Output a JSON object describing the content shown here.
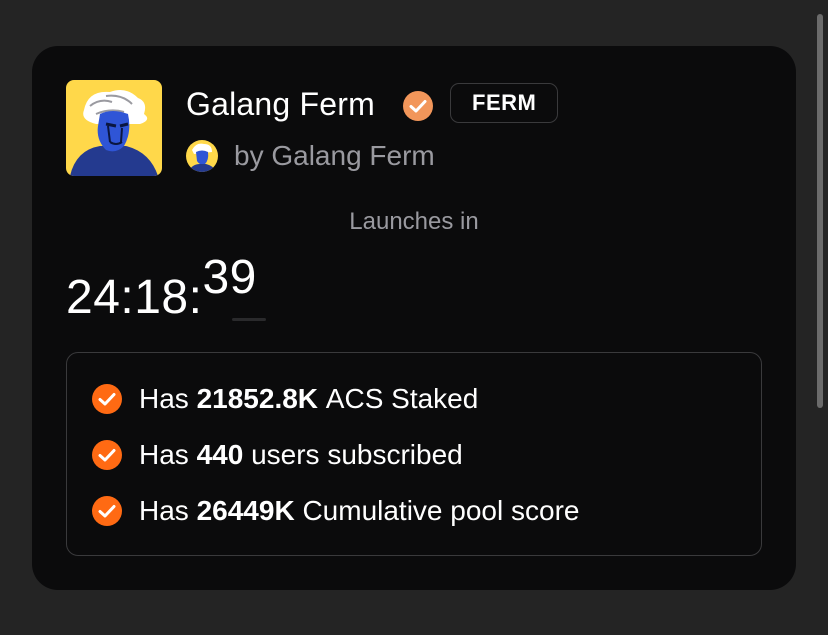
{
  "project": {
    "name": "Galang Ferm",
    "ticker": "FERM",
    "creator": "by Galang Ferm",
    "verified": true
  },
  "launch": {
    "label": "Launches in",
    "hours_minutes": "24:18:",
    "seconds": "39"
  },
  "criteria": [
    {
      "prefix": "Has",
      "value": "21852.8K",
      "suffix": "ACS Staked"
    },
    {
      "prefix": "Has",
      "value": "440",
      "suffix": "users subscribed"
    },
    {
      "prefix": "Has",
      "value": "26449K",
      "suffix": "Cumulative pool score"
    }
  ],
  "icons": {
    "verified": "verified-badge-icon",
    "check": "check-circle-icon"
  },
  "colors": {
    "accent_orange": "#ff6a13",
    "verified_orange": "#f2965a",
    "card_bg": "#0b0b0c",
    "page_bg": "#242424",
    "muted_text": "#9a9aa0",
    "avatar_yellow": "#ffd84a",
    "avatar_blue": "#2346b8"
  }
}
